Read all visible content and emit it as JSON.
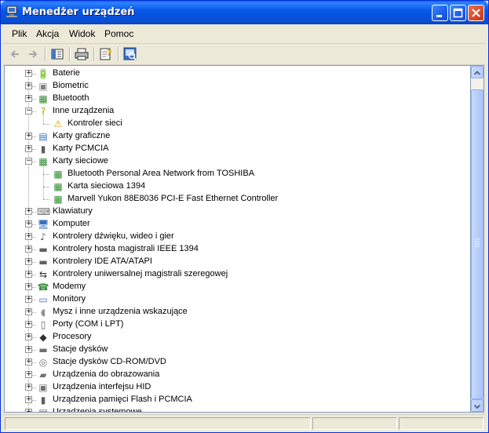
{
  "window": {
    "title": "Menedżer urządzeń"
  },
  "menu": {
    "items": [
      "Plik",
      "Akcja",
      "Widok",
      "Pomoc"
    ]
  },
  "tree": {
    "rows": [
      {
        "label": "Baterie",
        "level": 0,
        "expander": "+",
        "icon": "battery-icon",
        "glyph": "🔋",
        "color": "#2a5fb0"
      },
      {
        "label": "Biometric",
        "level": 0,
        "expander": "+",
        "icon": "biometric-icon",
        "glyph": "▣",
        "color": "#808080"
      },
      {
        "label": "Bluetooth",
        "level": 0,
        "expander": "+",
        "icon": "bluetooth-icon",
        "glyph": "▦",
        "color": "#2e8b2e"
      },
      {
        "label": "Inne urządzenia",
        "level": 0,
        "expander": "−",
        "icon": "question-icon",
        "glyph": "?",
        "color": "#c8a000"
      },
      {
        "label": "Kontroler sieci",
        "level": 1,
        "expander": "",
        "icon": "warning-icon",
        "glyph": "⚠",
        "color": "#d4a000"
      },
      {
        "label": "Karty graficzne",
        "level": 0,
        "expander": "+",
        "icon": "display-adapter-icon",
        "glyph": "▤",
        "color": "#3a6fc0"
      },
      {
        "label": "Karty PCMCIA",
        "level": 0,
        "expander": "+",
        "icon": "pcmcia-icon",
        "glyph": "▮",
        "color": "#606060"
      },
      {
        "label": "Karty sieciowe",
        "level": 0,
        "expander": "−",
        "icon": "network-card-icon",
        "glyph": "▦",
        "color": "#2e8b2e"
      },
      {
        "label": "Bluetooth Personal Area Network from TOSHIBA",
        "level": 1,
        "expander": "",
        "icon": "network-card-icon",
        "glyph": "▦",
        "color": "#2e8b2e"
      },
      {
        "label": "Karta sieciowa 1394",
        "level": 1,
        "expander": "",
        "icon": "network-card-icon",
        "glyph": "▦",
        "color": "#2e8b2e"
      },
      {
        "label": "Marvell Yukon 88E8036 PCI-E Fast Ethernet Controller",
        "level": 1,
        "expander": "",
        "icon": "network-card-icon",
        "glyph": "▦",
        "color": "#2e8b2e"
      },
      {
        "label": "Klawiatury",
        "level": 0,
        "expander": "+",
        "icon": "keyboard-icon",
        "glyph": "⌨",
        "color": "#707070"
      },
      {
        "label": "Komputer",
        "level": 0,
        "expander": "+",
        "icon": "computer-icon",
        "glyph": "🖥",
        "color": "#3a6fc0"
      },
      {
        "label": "Kontrolery dźwięku, wideo i gier",
        "level": 0,
        "expander": "+",
        "icon": "sound-icon",
        "glyph": "♪",
        "color": "#606060"
      },
      {
        "label": "Kontrolery hosta magistrali IEEE 1394",
        "level": 0,
        "expander": "+",
        "icon": "ieee1394-icon",
        "glyph": "▬",
        "color": "#606060"
      },
      {
        "label": "Kontrolery IDE ATA/ATAPI",
        "level": 0,
        "expander": "+",
        "icon": "ide-controller-icon",
        "glyph": "▬",
        "color": "#606060"
      },
      {
        "label": "Kontrolery uniwersalnej magistrali szeregowej",
        "level": 0,
        "expander": "+",
        "icon": "usb-icon",
        "glyph": "⇆",
        "color": "#303030"
      },
      {
        "label": "Modemy",
        "level": 0,
        "expander": "+",
        "icon": "modem-icon",
        "glyph": "☎",
        "color": "#2e8b2e"
      },
      {
        "label": "Monitory",
        "level": 0,
        "expander": "+",
        "icon": "monitor-icon",
        "glyph": "▭",
        "color": "#3a6fc0"
      },
      {
        "label": "Mysz i inne urządzenia wskazujące",
        "level": 0,
        "expander": "+",
        "icon": "mouse-icon",
        "glyph": "◖",
        "color": "#909090"
      },
      {
        "label": "Porty (COM i LPT)",
        "level": 0,
        "expander": "+",
        "icon": "port-icon",
        "glyph": "▯",
        "color": "#606060"
      },
      {
        "label": "Procesory",
        "level": 0,
        "expander": "+",
        "icon": "processor-icon",
        "glyph": "◆",
        "color": "#303030"
      },
      {
        "label": "Stacje dysków",
        "level": 0,
        "expander": "+",
        "icon": "disk-drive-icon",
        "glyph": "▬",
        "color": "#707070"
      },
      {
        "label": "Stacje dysków CD-ROM/DVD",
        "level": 0,
        "expander": "+",
        "icon": "cdrom-icon",
        "glyph": "◎",
        "color": "#707070"
      },
      {
        "label": "Urządzenia do obrazowania",
        "level": 0,
        "expander": "+",
        "icon": "imaging-icon",
        "glyph": "▰",
        "color": "#707070"
      },
      {
        "label": "Urządzenia interfejsu HID",
        "level": 0,
        "expander": "+",
        "icon": "hid-icon",
        "glyph": "▣",
        "color": "#707070"
      },
      {
        "label": "Urządzenia pamięci Flash i PCMCIA",
        "level": 0,
        "expander": "+",
        "icon": "flash-memory-icon",
        "glyph": "▮",
        "color": "#606060"
      },
      {
        "label": "Urządzenia systemowe",
        "level": 0,
        "expander": "+",
        "icon": "system-device-icon",
        "glyph": "▤",
        "color": "#606060"
      }
    ]
  }
}
